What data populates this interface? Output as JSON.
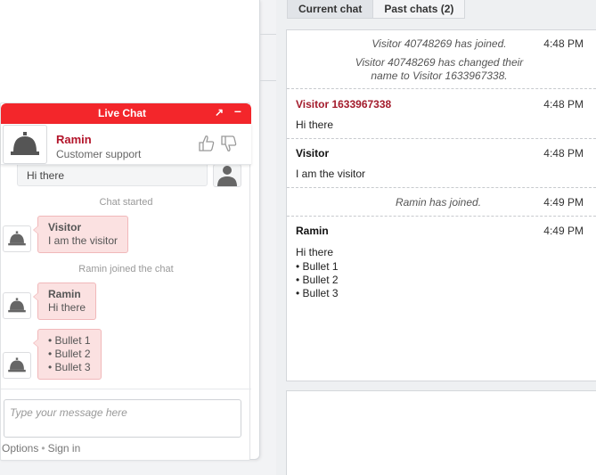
{
  "tabs": [
    {
      "label": "Current chat",
      "active": true
    },
    {
      "label": "Past chats (2)",
      "active": false
    }
  ],
  "transcript": {
    "system1": {
      "text": "Visitor 40748269 has joined.",
      "time": "4:48 PM"
    },
    "system2": {
      "text": "Visitor 40748269 has changed their name to Visitor 1633967338."
    },
    "msg1": {
      "name": "Visitor 1633967338",
      "text": "Hi there",
      "time": "4:48 PM"
    },
    "msg2": {
      "name": "Visitor",
      "text": "I am the visitor",
      "time": "4:48 PM"
    },
    "system3": {
      "text": "Ramin has joined.",
      "time": "4:49 PM"
    },
    "msg3": {
      "name": "Ramin",
      "text": "Hi there",
      "time": "4:49 PM",
      "bullets": [
        "Bullet 1",
        "Bullet 2",
        "Bullet 3"
      ]
    }
  },
  "widget": {
    "title": "Live Chat",
    "expand_icon": "↗",
    "minimize_icon": "–",
    "operator_name": "Ramin",
    "operator_role": "Customer support",
    "prev_message": "Hi there",
    "note_started": "Chat started",
    "note_joined": "Ramin joined the chat",
    "bubble1": {
      "name": "Visitor",
      "text": "I am the visitor"
    },
    "bubble2": {
      "name": "Ramin",
      "text": "Hi there"
    },
    "bubble3": {
      "bullets": [
        "Bullet 1",
        "Bullet 2",
        "Bullet 3"
      ]
    },
    "input_placeholder": "Type your message here",
    "link_options": "Options",
    "link_separator": "•",
    "link_signin": "Sign in"
  },
  "colors": {
    "header_red": "#f3262b",
    "operator_name": "#b3142a",
    "visitor_name": "#a31b2b",
    "bubble_bg": "#fbe1e1"
  },
  "icons": [
    "bell-avatar-icon",
    "visitor-avatar-icon",
    "thumbs-up-icon",
    "thumbs-down-icon",
    "expand-icon",
    "minimize-icon"
  ]
}
